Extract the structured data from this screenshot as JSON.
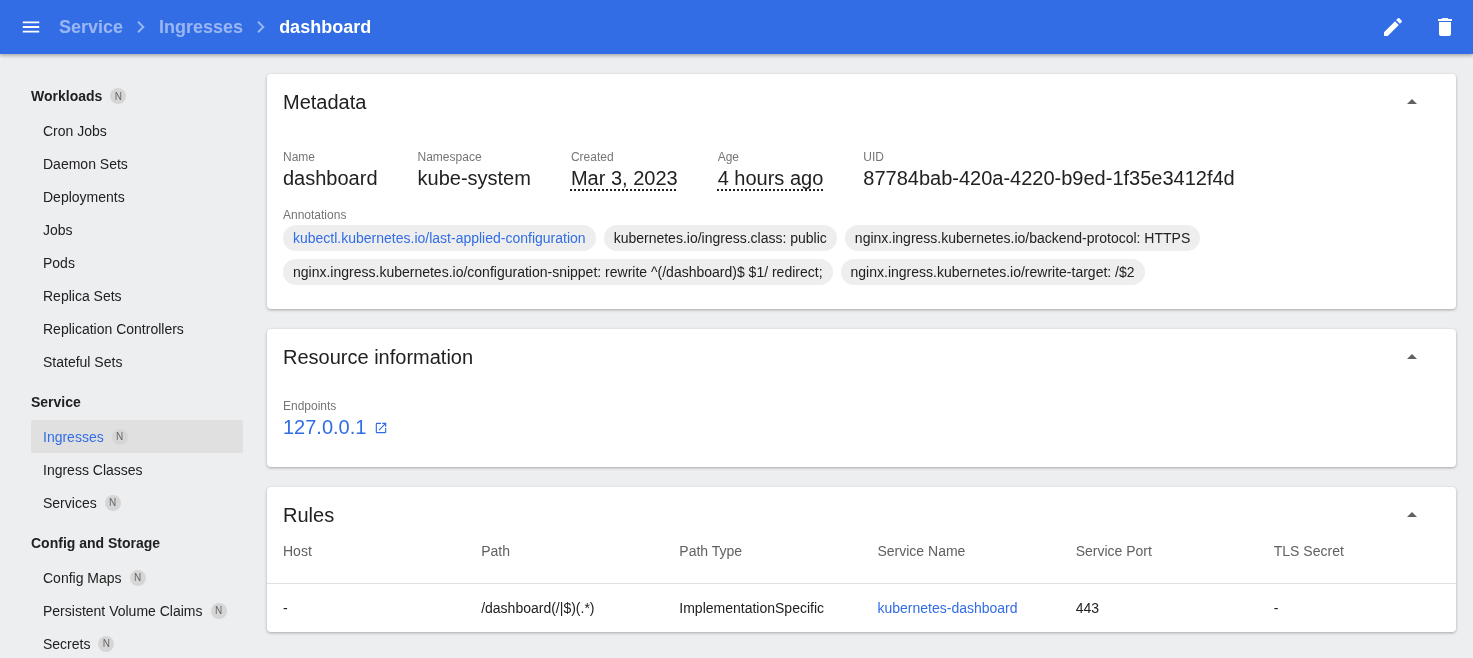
{
  "toolbar": {
    "breadcrumbs": [
      {
        "label": "Service",
        "current": false
      },
      {
        "label": "Ingresses",
        "current": false
      },
      {
        "label": "dashboard",
        "current": true
      }
    ]
  },
  "sidebar": {
    "sections": [
      {
        "title": "Workloads",
        "badge": "N",
        "items": [
          {
            "label": "Cron Jobs",
            "selected": false
          },
          {
            "label": "Daemon Sets",
            "selected": false
          },
          {
            "label": "Deployments",
            "selected": false
          },
          {
            "label": "Jobs",
            "selected": false
          },
          {
            "label": "Pods",
            "selected": false
          },
          {
            "label": "Replica Sets",
            "selected": false
          },
          {
            "label": "Replication Controllers",
            "selected": false
          },
          {
            "label": "Stateful Sets",
            "selected": false
          }
        ]
      },
      {
        "title": "Service",
        "items": [
          {
            "label": "Ingresses",
            "badge": "N",
            "selected": true
          },
          {
            "label": "Ingress Classes",
            "selected": false
          },
          {
            "label": "Services",
            "badge": "N",
            "selected": false
          }
        ]
      },
      {
        "title": "Config and Storage",
        "items": [
          {
            "label": "Config Maps",
            "badge": "N",
            "selected": false
          },
          {
            "label": "Persistent Volume Claims",
            "badge": "N",
            "selected": false
          },
          {
            "label": "Secrets",
            "badge": "N",
            "selected": false
          }
        ]
      }
    ]
  },
  "metadata": {
    "title": "Metadata",
    "expanded": true,
    "fields": [
      {
        "label": "Name",
        "value": "dashboard",
        "underlined": false
      },
      {
        "label": "Namespace",
        "value": "kube-system",
        "underlined": false
      },
      {
        "label": "Created",
        "value": "Mar 3, 2023",
        "underlined": true
      },
      {
        "label": "Age",
        "value": "4 hours ago",
        "underlined": true
      },
      {
        "label": "UID",
        "value": "87784bab-420a-4220-b9ed-1f35e3412f4d",
        "underlined": false
      }
    ],
    "annotations_label": "Annotations",
    "annotations": [
      {
        "text": "kubectl.kubernetes.io/last-applied-configuration",
        "kind": "link"
      },
      {
        "text": "kubernetes.io/ingress.class: public",
        "kind": "text"
      },
      {
        "text": "nginx.ingress.kubernetes.io/backend-protocol: HTTPS",
        "kind": "text"
      },
      {
        "text": "nginx.ingress.kubernetes.io/configuration-snippet: rewrite ^(/dashboard)$ $1/ redirect;",
        "kind": "text"
      },
      {
        "text": "nginx.ingress.kubernetes.io/rewrite-target: /$2",
        "kind": "text"
      }
    ]
  },
  "resource_information": {
    "title": "Resource information",
    "expanded": true,
    "endpoints_label": "Endpoints",
    "endpoints": [
      "127.0.0.1"
    ]
  },
  "rules": {
    "title": "Rules",
    "expanded": true,
    "columns": [
      "Host",
      "Path",
      "Path Type",
      "Service Name",
      "Service Port",
      "TLS Secret"
    ],
    "rows": [
      [
        {
          "text": "-",
          "kind": "text"
        },
        {
          "text": "/dashboard(/|$)(.*)",
          "kind": "text"
        },
        {
          "text": "ImplementationSpecific",
          "kind": "text"
        },
        {
          "text": "kubernetes-dashboard",
          "kind": "link"
        },
        {
          "text": "443",
          "kind": "text"
        },
        {
          "text": "-",
          "kind": "text"
        }
      ]
    ]
  }
}
